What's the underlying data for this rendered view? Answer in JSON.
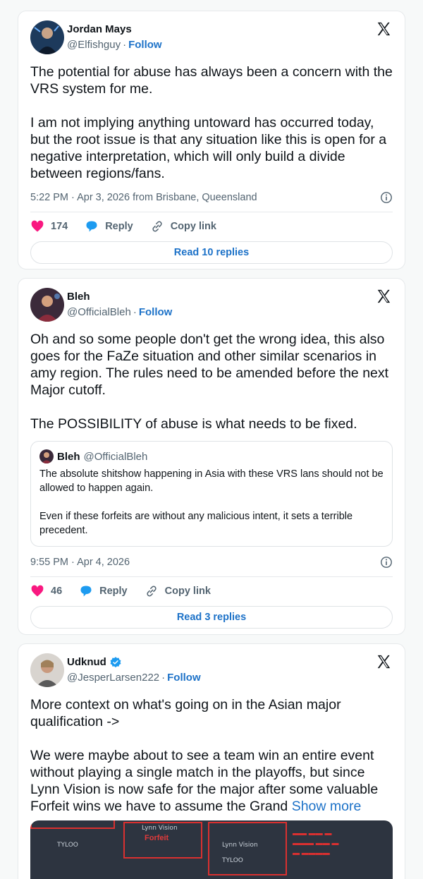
{
  "tweets": [
    {
      "author": "Jordan Mays",
      "handle": "@Elfishguy",
      "follow": "Follow",
      "text": "The potential for abuse has always been a concern with the VRS system for me.\n\nI am not implying anything untoward has occurred today, but the root issue is that any situation like this is open for a negative interpretation, which will only build a divide between regions/fans.",
      "meta": "5:22 PM · Apr 3, 2026 from Brisbane, Queensland",
      "likes": "174",
      "reply": "Reply",
      "copy": "Copy link",
      "read": "Read 10 replies"
    },
    {
      "author": "Bleh",
      "handle": "@OfficialBleh",
      "follow": "Follow",
      "text": "Oh and so some people don't get the wrong idea, this also goes for the FaZe situation and other similar scenarios in amy region. The rules need to be amended before the next Major cutoff.\n\nThe POSSIBILITY of abuse is what needs to be fixed.",
      "quote": {
        "author": "Bleh",
        "handle": "@OfficialBleh",
        "text": "The absolute shitshow happening in Asia with these VRS lans should not be allowed to happen again.\n\nEven if these forfeits are without any malicious intent, it sets a terrible precedent."
      },
      "meta": "9:55 PM · Apr 4, 2026",
      "likes": "46",
      "reply": "Reply",
      "copy": "Copy link",
      "read": "Read 3 replies"
    },
    {
      "author": "Udknud",
      "handle": "@JesperLarsen222",
      "follow": "Follow",
      "text": "More context on what's going on in the Asian major qualification ->\n\nWe were maybe about to see a team win an entire event without playing a single match in the playoffs, but since Lynn Vision is now safe for the major after some valuable Forfeit wins we have to assume the Grand",
      "show_more": "Show more",
      "media": {
        "team1": "TYLOO",
        "team2": "Lynn Vision",
        "forfeit": "Forfeit",
        "t3": "TYLOO"
      }
    }
  ],
  "colors": {
    "like": "#f91880",
    "link": "#1d72c8",
    "reply": "#1d9bf0"
  }
}
